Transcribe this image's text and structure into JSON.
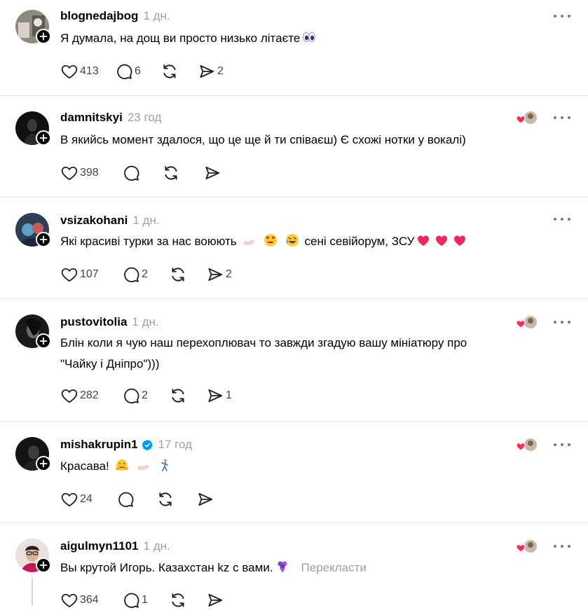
{
  "posts": [
    {
      "username": "blognedajbog",
      "time": "1 дн.",
      "verified": false,
      "liked_by_author": false,
      "text": "Я думала, на дощ ви просто низько літаєте",
      "emojis": [
        "eyes"
      ],
      "translate": "",
      "likes": "413",
      "replies": "6",
      "reposts": "",
      "shares": "2",
      "avatar": "avatar-blognedajbog"
    },
    {
      "username": "damnitskyi",
      "time": "23 год",
      "verified": false,
      "liked_by_author": true,
      "text": "В якийсь момент здалося, що це ще й ти співаєш) Є схожі нотки у вокалі)",
      "emojis": [],
      "translate": "",
      "likes": "398",
      "replies": "",
      "reposts": "",
      "shares": "",
      "avatar": "avatar-damnitskyi"
    },
    {
      "username": "vsizakohani",
      "time": "1 дн.",
      "verified": false,
      "liked_by_author": false,
      "text": "Які красиві турки за нас воюють",
      "text2": "сені севійорум, ЗСУ",
      "emojis": [
        "pinched-fingers",
        "heart-eyes",
        "rofl"
      ],
      "emojis2": [
        "red-heart",
        "red-heart",
        "red-heart"
      ],
      "translate": "",
      "likes": "107",
      "replies": "2",
      "reposts": "",
      "shares": "2",
      "avatar": "avatar-vsizakohani"
    },
    {
      "username": "pustovitolia",
      "time": "1 дн.",
      "verified": false,
      "liked_by_author": true,
      "text": "Блін коли я чую наш перехоплювач то завжди згадую вашу мініатюру про",
      "text_line2": "\"Чайку і Дніпро\")))",
      "emojis": [],
      "translate": "",
      "likes": "282",
      "replies": "2",
      "reposts": "",
      "shares": "1",
      "avatar": "avatar-pustovitolia"
    },
    {
      "username": "mishakrupin1",
      "time": "17 год",
      "verified": true,
      "liked_by_author": true,
      "text": "Красава!",
      "emojis": [
        "hugging-face",
        "pinched-fingers",
        "dancer"
      ],
      "translate": "",
      "likes": "24",
      "replies": "",
      "reposts": "",
      "shares": "",
      "avatar": "avatar-mishakrupin1"
    },
    {
      "username": "aigulmyn1101",
      "time": "1 дн.",
      "verified": false,
      "liked_by_author": true,
      "text": "Вы крутой Игорь. Казахстан kz с вами.",
      "emojis": [
        "bouquet"
      ],
      "translate": "Перекласти",
      "likes": "364",
      "replies": "1",
      "reposts": "",
      "shares": "",
      "avatar": "avatar-aigulmyn1101"
    }
  ],
  "icons": {
    "like": "heart-outline-icon",
    "reply": "comment-bubble-icon",
    "repost": "repost-arrows-icon",
    "share": "paper-plane-icon",
    "more": "more-dots-icon",
    "follow": "plus-icon"
  },
  "colors": {
    "muted": "#a0a0a0",
    "heart": "#ff2d55",
    "divider": "#e3e3e3"
  }
}
